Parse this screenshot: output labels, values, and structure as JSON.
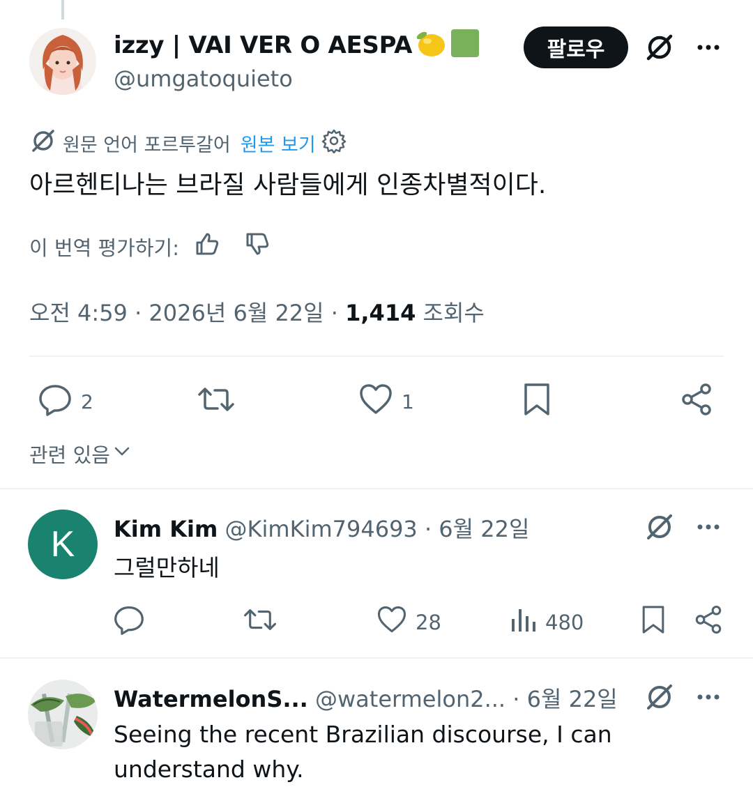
{
  "main_tweet": {
    "author_name": "izzy | VAI VER O AESPA",
    "author_handle": "@umgatoquieto",
    "follow_label": "팔로우",
    "translated_label": "원문 언어 포르투갈어",
    "show_original_label": "원본 보기",
    "text": "아르헨티나는 브라질 사람들에게 인종차별적이다.",
    "rate_label": "이 번역 평가하기:",
    "timestamp": "오전 4:59 · 2026년 6월 22일 · ",
    "views_count": "1,414",
    "views_label": " 조회수",
    "actions": {
      "replies": "2",
      "likes": "1"
    },
    "icons": [
      "avatar",
      "lemon-emoji",
      "green-square-emoji",
      "grok-icon",
      "more-icon",
      "translate-icon",
      "settings-icon",
      "thumbs-up-icon",
      "thumbs-down-icon",
      "reply-icon",
      "retweet-icon",
      "heart-icon",
      "bookmark-icon",
      "share-icon"
    ]
  },
  "related_label": "관련 있음",
  "replies": [
    {
      "name": "Kim Kim",
      "handle": "@KimKim794693",
      "date": "· 6월 22일",
      "avatar_letter": "K",
      "text": "그럴만하네",
      "likes": "28",
      "views": "480"
    },
    {
      "name": "WatermelonS...",
      "handle": "@watermelon2...",
      "date": " · 6월 22일",
      "text_line1": "Seeing the recent Brazilian discourse, I can",
      "text_line2": "understand why."
    }
  ],
  "colors": {
    "text": "#0f1419",
    "secondary": "#536471",
    "link": "#1d9bf0",
    "divider": "#eff3f4",
    "k_avatar": "#19836f"
  }
}
